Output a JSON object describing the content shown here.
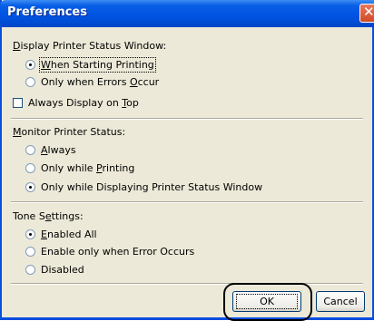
{
  "window": {
    "title": "Preferences"
  },
  "status_window": {
    "label_pre": "",
    "label_ul": "D",
    "label_post": "isplay Printer Status Window:",
    "options": [
      {
        "pre": "",
        "ul": "W",
        "post": "hen Starting Printing",
        "selected": true
      },
      {
        "pre": "Only when Errors ",
        "ul": "O",
        "post": "ccur",
        "selected": false
      }
    ],
    "always_on_top": {
      "pre": "Always Display on ",
      "ul": "T",
      "post": "op",
      "checked": false
    }
  },
  "monitor_status": {
    "label_pre": "",
    "label_ul": "M",
    "label_post": "onitor Printer Status:",
    "options": [
      {
        "pre": "",
        "ul": "A",
        "post": "lways",
        "selected": false
      },
      {
        "pre": "Only while ",
        "ul": "P",
        "post": "rinting",
        "selected": false
      },
      {
        "pre": "Only while Displaying Printer Status Window",
        "ul": "",
        "post": "",
        "selected": true
      }
    ]
  },
  "tone_settings": {
    "label_pre": "Tone S",
    "label_ul": "e",
    "label_post": "ttings:",
    "options": [
      {
        "pre": "",
        "ul": "E",
        "post": "nabled All",
        "selected": true
      },
      {
        "pre": "Enable only when Error Occurs",
        "ul": "",
        "post": "",
        "selected": false
      },
      {
        "pre": "Disabled",
        "ul": "",
        "post": "",
        "selected": false
      }
    ]
  },
  "buttons": {
    "ok": "OK",
    "cancel": "Cancel"
  }
}
